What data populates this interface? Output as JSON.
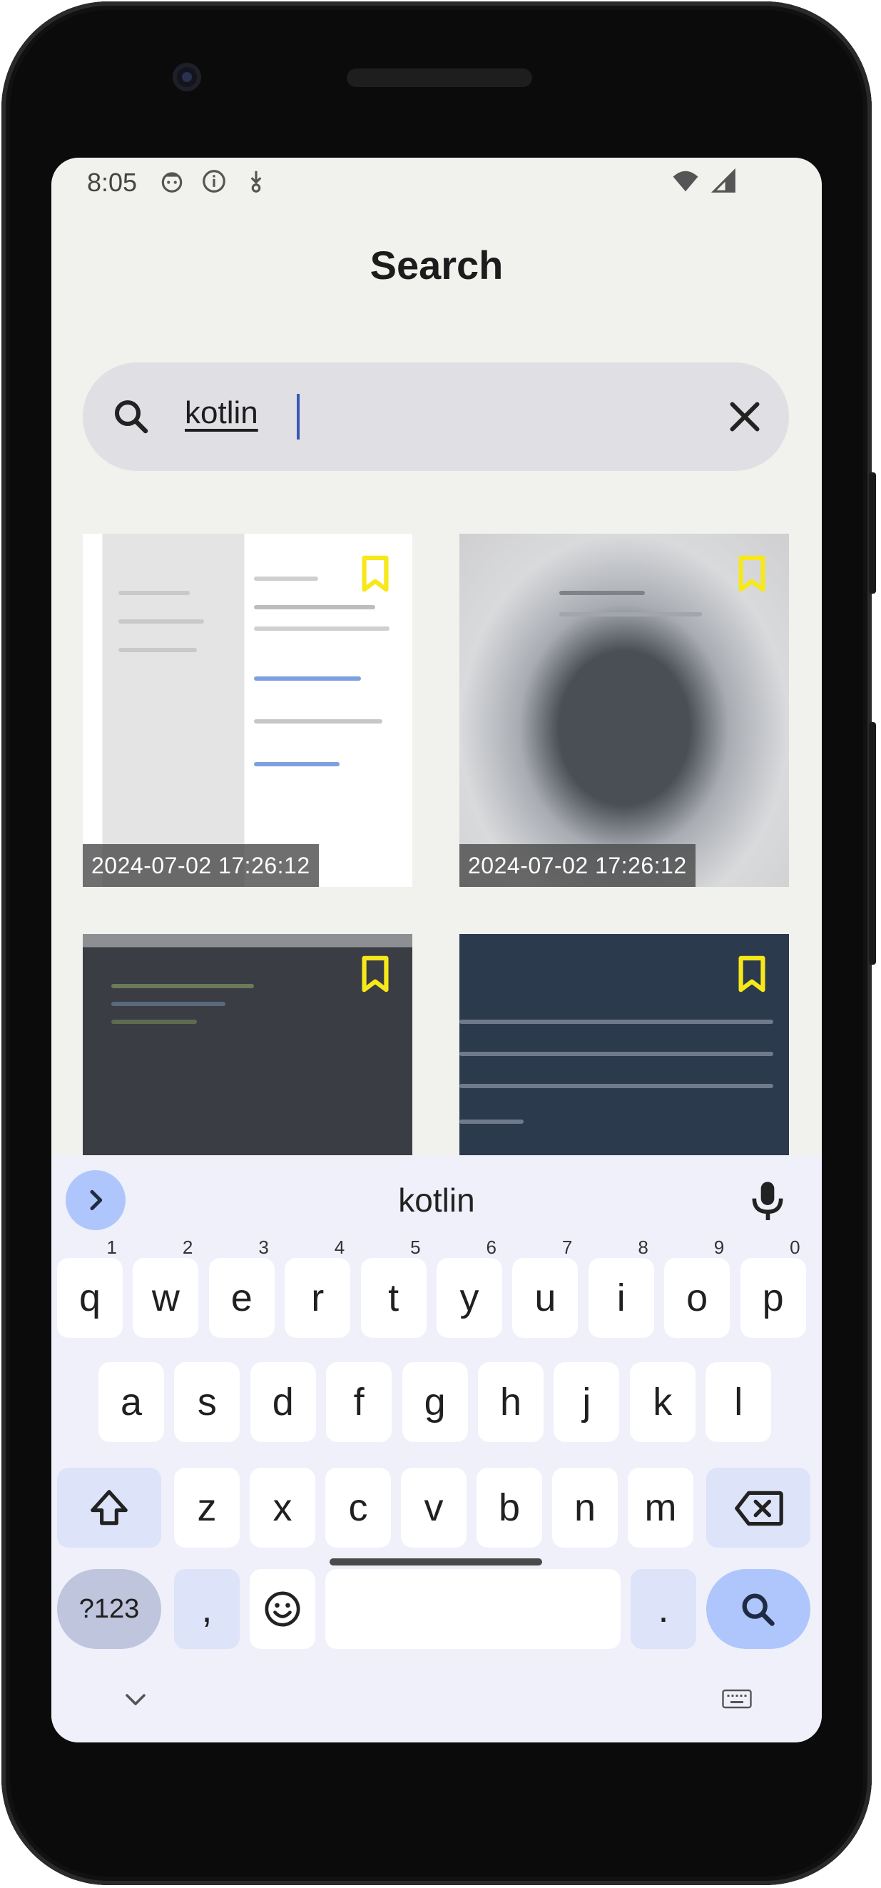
{
  "status_bar": {
    "time": "8:05",
    "icons": [
      "face-notification-icon",
      "info-icon",
      "download-icon",
      "wifi-icon",
      "signal-icon"
    ]
  },
  "header": {
    "title": "Search"
  },
  "search": {
    "query": "kotlin",
    "search_icon": "search-icon",
    "clear_icon": "close-icon"
  },
  "results": [
    {
      "timestamp": "2024-07-02 17:26:12",
      "bookmark_icon": "bookmark-icon"
    },
    {
      "timestamp": "2024-07-02 17:26:12",
      "bookmark_icon": "bookmark-icon"
    },
    {
      "timestamp": "",
      "bookmark_icon": "bookmark-icon"
    },
    {
      "timestamp": "",
      "bookmark_icon": "bookmark-icon"
    }
  ],
  "keyboard": {
    "suggestion": "kotlin",
    "row1": [
      {
        "k": "q",
        "n": "1"
      },
      {
        "k": "w",
        "n": "2"
      },
      {
        "k": "e",
        "n": "3"
      },
      {
        "k": "r",
        "n": "4"
      },
      {
        "k": "t",
        "n": "5"
      },
      {
        "k": "y",
        "n": "6"
      },
      {
        "k": "u",
        "n": "7"
      },
      {
        "k": "i",
        "n": "8"
      },
      {
        "k": "o",
        "n": "9"
      },
      {
        "k": "p",
        "n": "0"
      }
    ],
    "row2": [
      "a",
      "s",
      "d",
      "f",
      "g",
      "h",
      "j",
      "k",
      "l"
    ],
    "row3": [
      "z",
      "x",
      "c",
      "v",
      "b",
      "n",
      "m"
    ],
    "symbols_label": "?123",
    "comma_label": ",",
    "period_label": "."
  },
  "colors": {
    "accent": "#aec6fb",
    "bookmark": "#f7e81a",
    "screen_bg": "#f1f1ed",
    "keyboard_bg": "#eff0fa"
  }
}
